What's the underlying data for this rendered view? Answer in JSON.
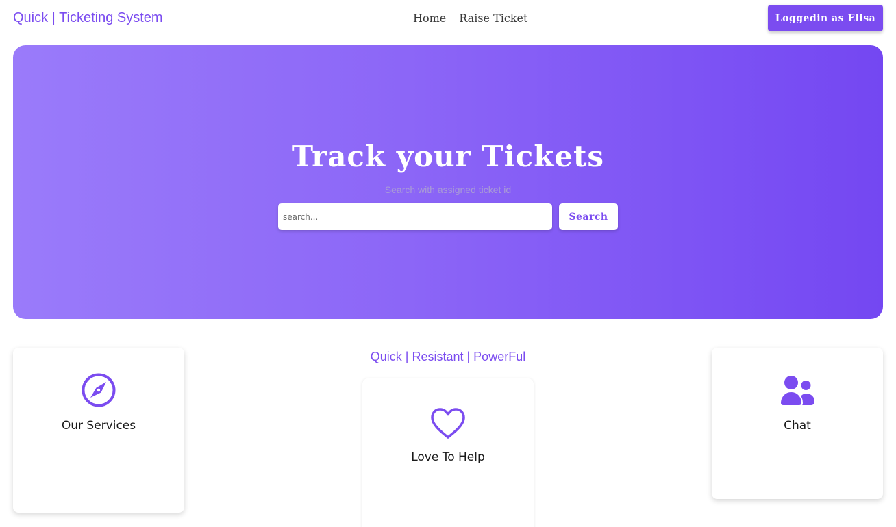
{
  "navbar": {
    "brand": "Quick | Ticketing System",
    "links": [
      {
        "label": "Home"
      },
      {
        "label": "Raise Ticket"
      }
    ],
    "login_label": "Loggedin as Elisa"
  },
  "hero": {
    "title": "Track your Tickets",
    "subtitle": "Search with assigned ticket id",
    "search_placeholder": "search...",
    "search_button": "Search"
  },
  "tagline": "Quick | Resistant | PowerFul",
  "cards": [
    {
      "label": "Our Services",
      "icon": "compass-icon"
    },
    {
      "label": "Love To Help",
      "icon": "heart-icon"
    },
    {
      "label": "Chat",
      "icon": "users-icon"
    }
  ],
  "colors": {
    "accent": "#7b4cf0",
    "hero_gradient_start": "#9a7bfa",
    "hero_gradient_end": "#7447f2"
  }
}
